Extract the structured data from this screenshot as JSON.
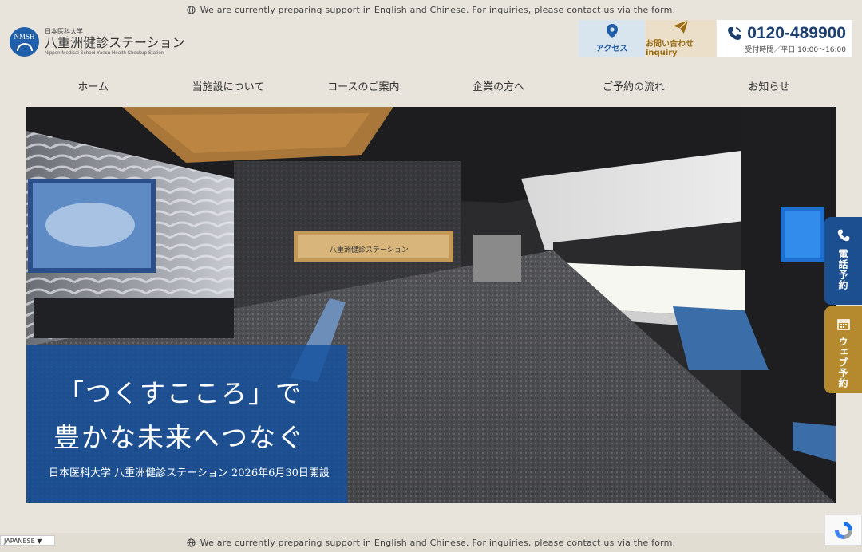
{
  "notice": {
    "text": "We are currently preparing support in English and Chinese. For inquiries, please contact us via the form."
  },
  "logo": {
    "badge": "NMSH",
    "sub": "日本医科大学",
    "main": "八重洲健診ステーション",
    "en": "Nippon Medical School Yaesu Health Checkup Station"
  },
  "header": {
    "access_label": "アクセス",
    "inquiry_label": "お問い合わせ inquiry",
    "phone_number": "0120-489900",
    "phone_hours": "受付時間／平日 10:00〜16:00"
  },
  "nav": {
    "items": [
      {
        "label": "ホーム"
      },
      {
        "label": "当施設について"
      },
      {
        "label": "コースのご案内"
      },
      {
        "label": "企業の方へ"
      },
      {
        "label": "ご予約の流れ"
      },
      {
        "label": "お知らせ"
      }
    ]
  },
  "hero": {
    "line1": "「つくすこころ」で",
    "line2": "豊かな未来へつなぐ",
    "caption": "日本医科大学 八重洲健診ステーション 2026年6月30日開設",
    "sign_text": "八重洲健診ステーション"
  },
  "side": {
    "tel_label": "電話予約",
    "web_label": "ウェブ予約"
  },
  "language": {
    "selected": "JAPANESE ▼"
  },
  "colors": {
    "background": "#e8e4db",
    "brand_blue": "#1f5ea8",
    "navy": "#1c3f6e",
    "gold": "#b58a2e"
  }
}
